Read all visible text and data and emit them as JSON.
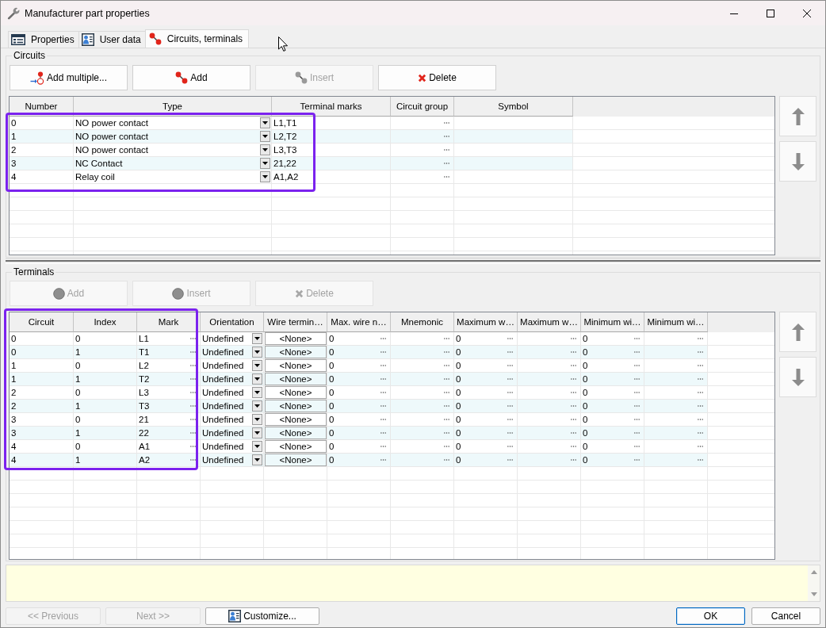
{
  "window": {
    "title": "Manufacturer part properties"
  },
  "tabs": [
    {
      "label": "Properties",
      "selected": false
    },
    {
      "label": "User data",
      "selected": false
    },
    {
      "label": "Circuits, terminals",
      "selected": true
    }
  ],
  "sections": [
    {
      "title": "Circuits",
      "buttons": [
        {
          "label": "Add multiple...",
          "disabled": false
        },
        {
          "label": "Add",
          "disabled": false
        },
        {
          "label": "Insert",
          "disabled": true
        },
        {
          "label": "Delete",
          "disabled": false
        }
      ],
      "table": {
        "highlighted": true,
        "columns": [
          {
            "label": "Number",
            "kind": "text"
          },
          {
            "label": "Type",
            "kind": "dropdown"
          },
          {
            "label": "Terminal marks",
            "kind": "text"
          },
          {
            "label": "Circuit group",
            "kind": "browse"
          },
          {
            "label": "Symbol",
            "kind": "text"
          }
        ],
        "rows": [
          [
            "0",
            "NO power contact",
            "L1,T1",
            null,
            null
          ],
          [
            "1",
            "NO power contact",
            "L2,T2",
            null,
            null
          ],
          [
            "2",
            "NO power contact",
            "L3,T3",
            null,
            null
          ],
          [
            "3",
            "NC Contact",
            "21,22",
            null,
            null
          ],
          [
            "4",
            "Relay coil",
            "A1,A2",
            null,
            null
          ]
        ]
      }
    },
    {
      "title": "Terminals",
      "buttons": [
        {
          "label": "Add",
          "disabled": true
        },
        {
          "label": "Insert",
          "disabled": true
        },
        {
          "label": "Delete",
          "disabled": true
        }
      ],
      "table": {
        "highlighted": true,
        "columns": [
          {
            "label": "Circuit",
            "kind": "text"
          },
          {
            "label": "Index",
            "kind": "text"
          },
          {
            "label": "Mark",
            "kind": "browse"
          },
          {
            "label": "Orientation",
            "kind": "dropdown"
          },
          {
            "label": "Wire termin…",
            "kind": "picker"
          },
          {
            "label": "Max. wire n…",
            "kind": "browse"
          },
          {
            "label": "Mnemonic",
            "kind": "browse"
          },
          {
            "label": "Maximum w…",
            "kind": "browse"
          },
          {
            "label": "Maximum w…",
            "kind": "browse"
          },
          {
            "label": "Minimum wi…",
            "kind": "browse"
          },
          {
            "label": "Minimum wi…",
            "kind": "browse"
          }
        ],
        "rows": [
          [
            "0",
            "0",
            "L1",
            "Undefined",
            "<None>",
            "0",
            null,
            "0",
            null,
            "0",
            null
          ],
          [
            "0",
            "1",
            "T1",
            "Undefined",
            "<None>",
            "0",
            null,
            "0",
            null,
            "0",
            null
          ],
          [
            "1",
            "0",
            "L2",
            "Undefined",
            "<None>",
            "0",
            null,
            "0",
            null,
            "0",
            null
          ],
          [
            "1",
            "1",
            "T2",
            "Undefined",
            "<None>",
            "0",
            null,
            "0",
            null,
            "0",
            null
          ],
          [
            "2",
            "0",
            "L3",
            "Undefined",
            "<None>",
            "0",
            null,
            "0",
            null,
            "0",
            null
          ],
          [
            "2",
            "1",
            "T3",
            "Undefined",
            "<None>",
            "0",
            null,
            "0",
            null,
            "0",
            null
          ],
          [
            "3",
            "0",
            "21",
            "Undefined",
            "<None>",
            "0",
            null,
            "0",
            null,
            "0",
            null
          ],
          [
            "3",
            "1",
            "22",
            "Undefined",
            "<None>",
            "0",
            null,
            "0",
            null,
            "0",
            null
          ],
          [
            "4",
            "0",
            "A1",
            "Undefined",
            "<None>",
            "0",
            null,
            "0",
            null,
            "0",
            null
          ],
          [
            "4",
            "1",
            "A2",
            "Undefined",
            "<None>",
            "0",
            null,
            "0",
            null,
            "0",
            null
          ]
        ]
      }
    }
  ],
  "footer": {
    "left_buttons": [
      {
        "label": "<< Previous",
        "disabled": true,
        "default": false
      },
      {
        "label": "Next >>",
        "disabled": true,
        "default": false
      },
      {
        "label": "Customize...",
        "disabled": false,
        "default": false
      }
    ],
    "right_buttons": [
      {
        "label": "OK",
        "disabled": false,
        "default": true
      },
      {
        "label": "Cancel",
        "disabled": false,
        "default": false
      }
    ]
  }
}
